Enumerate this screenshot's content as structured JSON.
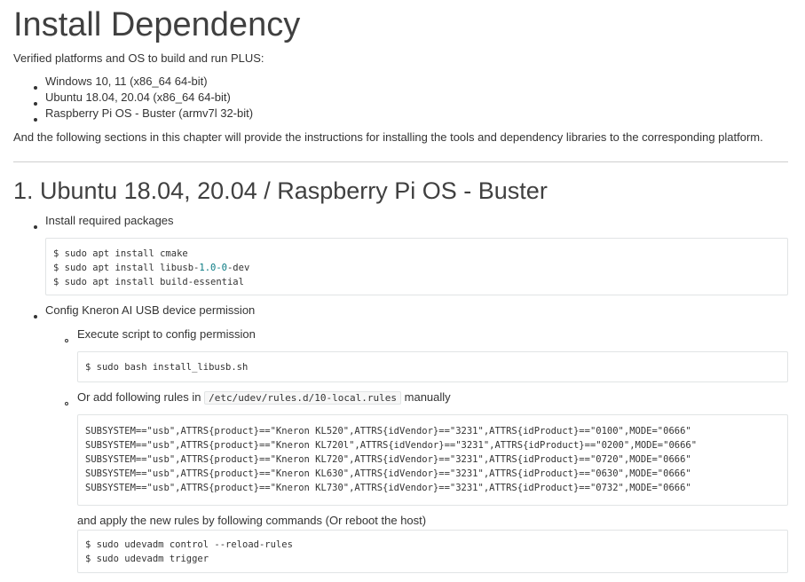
{
  "title": "Install Dependency",
  "intro": "Verified platforms and OS to build and run PLUS:",
  "platforms": [
    "Windows 10, 11 (x86_64 64-bit)",
    "Ubuntu 18.04, 20.04 (x86_64 64-bit)",
    "Raspberry Pi OS - Buster (armv7l 32-bit)"
  ],
  "following_text": "And the following sections in this chapter will provide the instructions for installing the tools and dependency libraries to the corresponding platform.",
  "section1": {
    "title": "1. Ubuntu 18.04, 20.04 / Raspberry Pi OS - Buster",
    "install_packages_label": "Install required packages",
    "install_commands": [
      "$ sudo apt install cmake",
      "$ sudo apt install libusb-1.0-0-dev",
      "$ sudo apt install build-essential"
    ],
    "config_label": "Config Kneron AI USB device permission",
    "execute_label": "Execute script to config permission",
    "execute_command": "$ sudo bash install_libusb.sh",
    "rules_prefix": "Or add following rules in",
    "rules_path": "/etc/udev/rules.d/10-local.rules",
    "rules_suffix": "manually",
    "rules": [
      "SUBSYSTEM==\"usb\",ATTRS{product}==\"Kneron KL520\",ATTRS{idVendor}==\"3231\",ATTRS{idProduct}==\"0100\",MODE=\"0666\"",
      "SUBSYSTEM==\"usb\",ATTRS{product}==\"Kneron KL720l\",ATTRS{idVendor}==\"3231\",ATTRS{idProduct}==\"0200\",MODE=\"0666\"",
      "SUBSYSTEM==\"usb\",ATTRS{product}==\"Kneron KL720\",ATTRS{idVendor}==\"3231\",ATTRS{idProduct}==\"0720\",MODE=\"0666\"",
      "SUBSYSTEM==\"usb\",ATTRS{product}==\"Kneron KL630\",ATTRS{idVendor}==\"3231\",ATTRS{idProduct}==\"0630\",MODE=\"0666\"",
      "SUBSYSTEM==\"usb\",ATTRS{product}==\"Kneron KL730\",ATTRS{idVendor}==\"3231\",ATTRS{idProduct}==\"0732\",MODE=\"0666\""
    ],
    "apply_label": "and apply the new rules by following commands (Or reboot the host)",
    "apply_commands": [
      "$ sudo udevadm control --reload-rules",
      "$ sudo udevadm trigger"
    ]
  }
}
